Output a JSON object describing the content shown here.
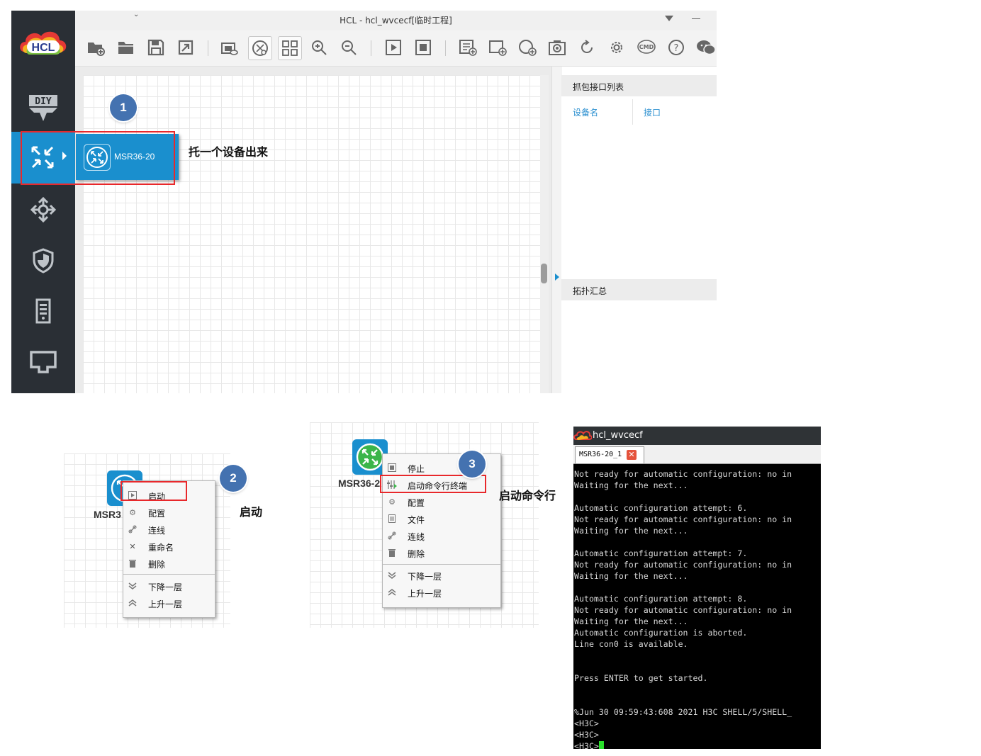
{
  "window": {
    "title": "HCL - hcl_wvcecf[临时工程]",
    "logo_text": "HCL",
    "brand_color": "#1a8fce",
    "accent_color": "#e8282b"
  },
  "sidebar": {
    "items": [
      {
        "icon": "diy-icon",
        "label": "DIY"
      },
      {
        "icon": "router-icon",
        "label": "",
        "selected": true
      },
      {
        "icon": "switch-icon",
        "label": ""
      },
      {
        "icon": "firewall-shield-icon",
        "label": ""
      },
      {
        "icon": "server-icon",
        "label": ""
      },
      {
        "icon": "terminal-icon",
        "label": ""
      }
    ]
  },
  "toolbar": {
    "icons": [
      "new-project-icon",
      "open-folder-icon",
      "save-icon",
      "export-icon",
      "screenshot-icon",
      "show-hide-icon",
      "grid-view-icon",
      "zoom-in-icon",
      "zoom-out-icon",
      "start-all-icon",
      "stop-all-icon",
      "import-log-icon",
      "add-shape-icon",
      "add-text-icon",
      "camera-icon",
      "refresh-icon",
      "settings-icon",
      "cmd-icon",
      "help-icon",
      "wechat-icon"
    ]
  },
  "device_flyout": {
    "device_name": "MSR36-20"
  },
  "right_panel": {
    "capture_title": "抓包接口列表",
    "col_device": "设备名",
    "col_interface": "接口",
    "topology_title": "拓扑汇总"
  },
  "annotations": {
    "step1_number": "1",
    "step1_text": "托一个设备出来",
    "step2_number": "2",
    "step2_text": "启动",
    "step3_number": "3",
    "step3_text": "启动命令行"
  },
  "menu1": {
    "device_label": "MSR3",
    "items": [
      {
        "icon": "play-icon",
        "label": "启动"
      },
      {
        "icon": "gear-icon",
        "label": "配置"
      },
      {
        "icon": "link-icon",
        "label": "连线"
      },
      {
        "icon": "rename-icon",
        "label": "重命名"
      },
      {
        "icon": "trash-icon",
        "label": "删除"
      }
    ],
    "layer_items": [
      {
        "icon": "chevron-down-icon",
        "label": "下降一层"
      },
      {
        "icon": "chevron-up-icon",
        "label": "上升一层"
      }
    ]
  },
  "menu2": {
    "device_label": "MSR36-2",
    "items": [
      {
        "icon": "stop-icon",
        "label": "停止"
      },
      {
        "icon": "cli-terminal-icon",
        "label": "启动命令行终端"
      },
      {
        "icon": "gear-icon",
        "label": "配置"
      },
      {
        "icon": "file-icon",
        "label": "文件"
      },
      {
        "icon": "link-icon",
        "label": "连线"
      },
      {
        "icon": "trash-icon",
        "label": "删除"
      }
    ],
    "layer_items": [
      {
        "icon": "chevron-down-icon",
        "label": "下降一层"
      },
      {
        "icon": "chevron-up-icon",
        "label": "上升一层"
      }
    ]
  },
  "terminal": {
    "window_title": "hcl_wvcecf",
    "tab_label": "MSR36-20_1",
    "lines": [
      "Not ready for automatic configuration: no in",
      "Waiting for the next...",
      "",
      "Automatic configuration attempt: 6.",
      "Not ready for automatic configuration: no in",
      "Waiting for the next...",
      "",
      "Automatic configuration attempt: 7.",
      "Not ready for automatic configuration: no in",
      "Waiting for the next...",
      "",
      "Automatic configuration attempt: 8.",
      "Not ready for automatic configuration: no in",
      "Waiting for the next...",
      "Automatic configuration is aborted.",
      "Line con0 is available.",
      "",
      "",
      "Press ENTER to get started.",
      "",
      "",
      "%Jun 30 09:59:43:608 2021 H3C SHELL/5/SHELL_",
      "<H3C>",
      "<H3C>"
    ],
    "prompt": "<H3C>"
  }
}
